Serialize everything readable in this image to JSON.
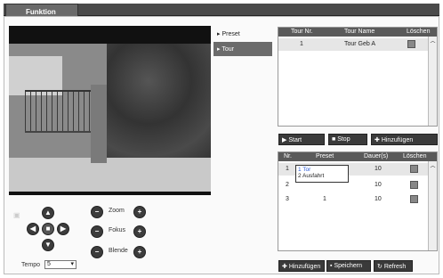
{
  "tab": {
    "label": "Funktion"
  },
  "nav": {
    "items": [
      {
        "label": "Preset",
        "active": false
      },
      {
        "label": "Tour",
        "active": true
      }
    ]
  },
  "ptz": {
    "zoom_label": "Zoom",
    "focus_label": "Fokus",
    "iris_label": "Blende",
    "speed_label": "Tempo",
    "speed_value": "5"
  },
  "tour_table": {
    "headers": [
      "Tour Nr.",
      "Tour Name",
      "Löschen"
    ],
    "rows": [
      {
        "nr": "1",
        "name": "Tour Geb A"
      }
    ]
  },
  "tour_buttons": {
    "start": "Start",
    "stop": "Stop",
    "add": "Hinzufügen"
  },
  "preset_table": {
    "headers": [
      "Nr.",
      "Preset",
      "Dauer(s)",
      "Löschen"
    ],
    "rows": [
      {
        "nr": "1",
        "preset": "",
        "duration": "10"
      },
      {
        "nr": "2",
        "preset": "",
        "duration": "10"
      },
      {
        "nr": "3",
        "preset": "1",
        "duration": "10"
      }
    ],
    "dropdown_options": [
      "1  Tor",
      "2  Ausfahrt"
    ]
  },
  "bottom_buttons": {
    "add": "Hinzufügen",
    "save": "Speichern",
    "refresh": "Refresh"
  }
}
